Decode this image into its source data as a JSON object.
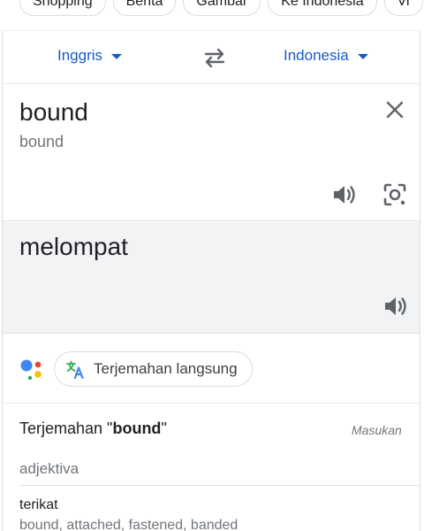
{
  "chips": [
    "Shopping",
    "Berita",
    "Gambar",
    "Ke Indonesia",
    "Vi"
  ],
  "languages": {
    "source": "Inggris",
    "target": "Indonesia"
  },
  "source": {
    "text": "bound",
    "transliteration": "bound"
  },
  "target": {
    "text": "melompat"
  },
  "live": {
    "label": "Terjemahan langsung"
  },
  "translations": {
    "title_prefix": "Terjemahan \"",
    "title_word": "bound",
    "title_suffix": "\"",
    "feedback": "Masukan",
    "part_of_speech": "adjektiva",
    "entries": [
      {
        "word": "terikat",
        "synonyms": "bound, attached, fastened, banded"
      }
    ]
  },
  "colors": {
    "accent": "#1a5bc4",
    "google_blue": "#4285f4",
    "google_red": "#ea4335",
    "google_yellow": "#fbbc04",
    "google_green": "#34a853"
  },
  "icons": [
    "chevron-down-icon",
    "swap-icon",
    "close-icon",
    "speaker-icon",
    "lens-camera-icon",
    "assistant-icon",
    "translate-icon"
  ]
}
